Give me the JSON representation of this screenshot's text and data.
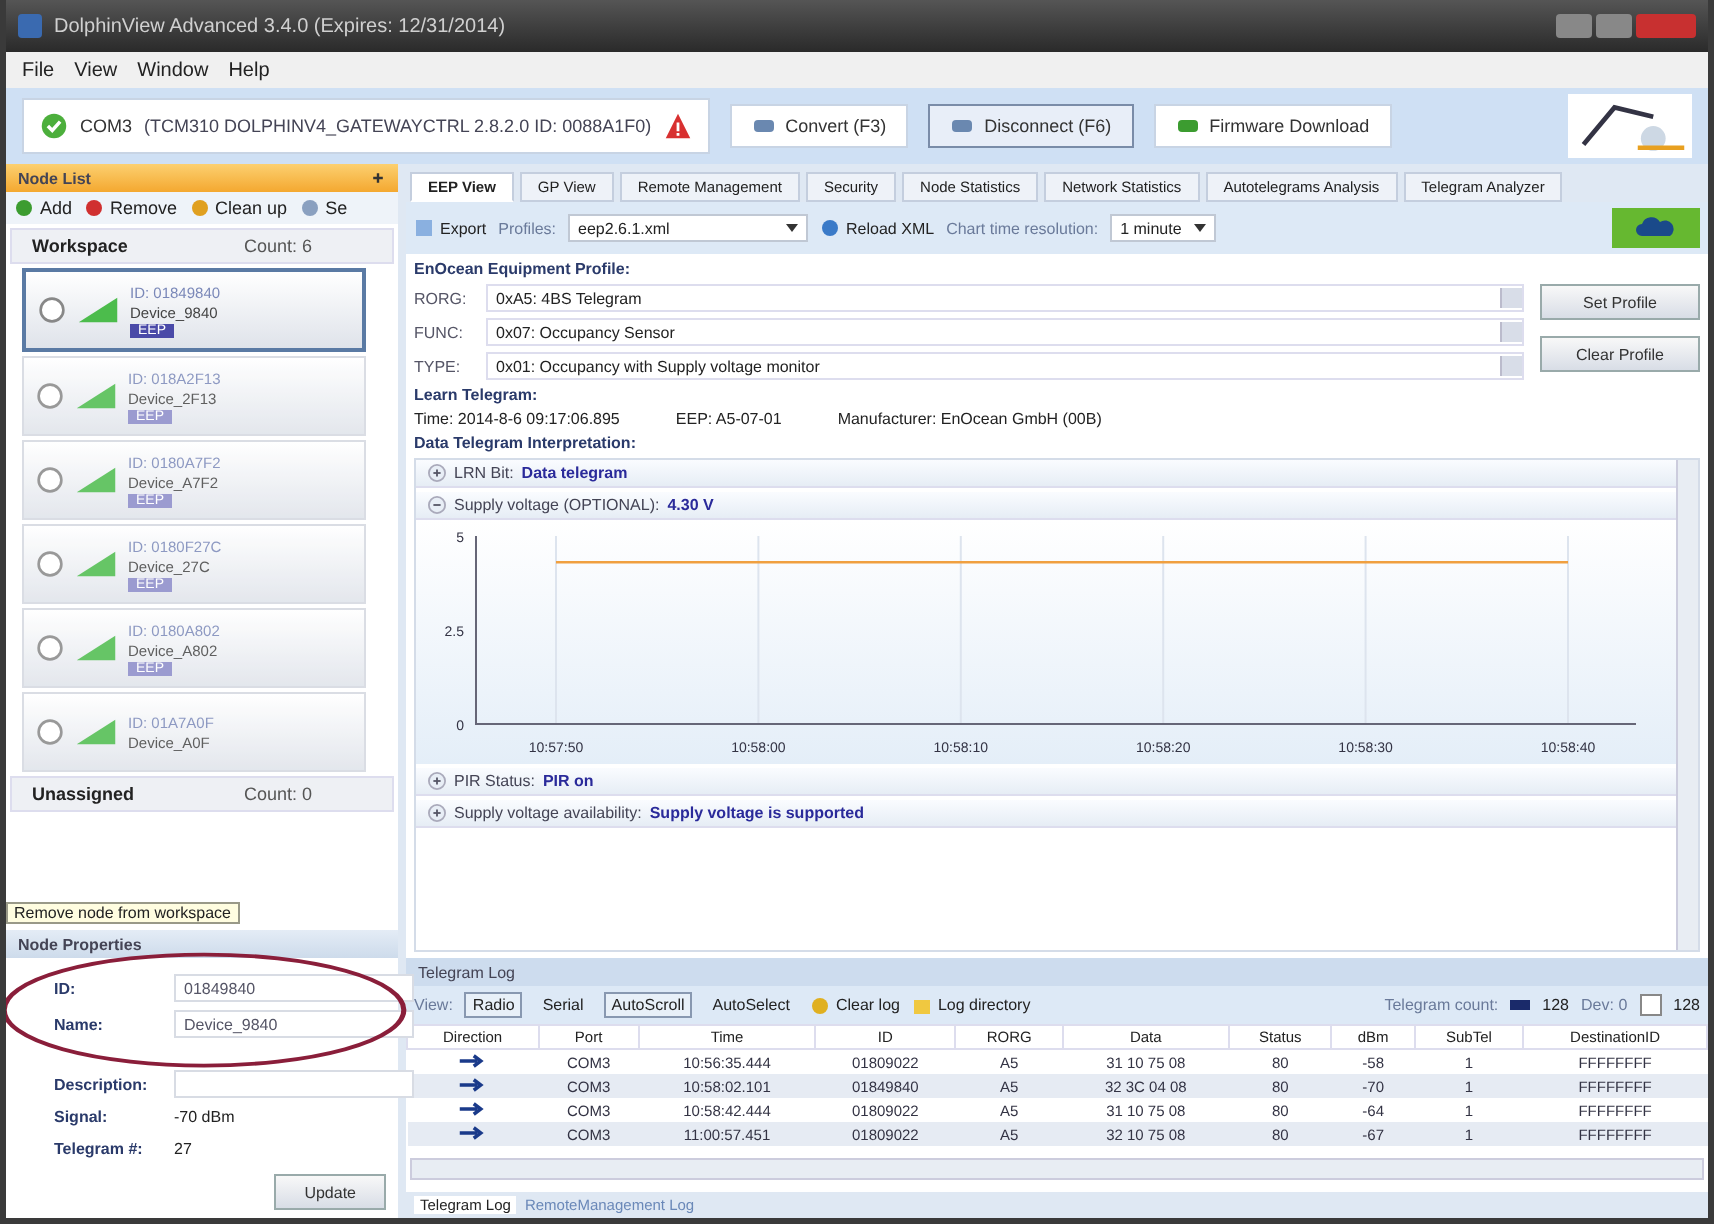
{
  "window": {
    "title": "DolphinView Advanced 3.4.0 (Expires: 12/31/2014)"
  },
  "menu": [
    "File",
    "View",
    "Window",
    "Help"
  ],
  "connection": {
    "port": "COM3",
    "info": "(TCM310 DOLPHINV4_GATEWAYCTRL 2.8.2.0 ID: 0088A1F0)",
    "buttons": [
      {
        "label": "Convert (F3)",
        "selected": false
      },
      {
        "label": "Disconnect (F6)",
        "selected": true
      },
      {
        "label": "Firmware Download",
        "selected": false
      }
    ]
  },
  "node_list": {
    "title": "Node List",
    "tools": [
      "Add",
      "Remove",
      "Clean up",
      "Se"
    ],
    "workspace": {
      "label": "Workspace",
      "count": "Count: 6"
    },
    "nodes": [
      {
        "id": "ID: 01849840",
        "name": "Device_9840",
        "badge": "EEP",
        "selected": true
      },
      {
        "id": "ID: 018A2F13",
        "name": "Device_2F13",
        "badge": "EEP",
        "selected": false
      },
      {
        "id": "ID: 0180A7F2",
        "name": "Device_A7F2",
        "badge": "EEP",
        "selected": false
      },
      {
        "id": "ID: 0180F27C",
        "name": "Device_27C",
        "badge": "EEP",
        "selected": false
      },
      {
        "id": "ID: 0180A802",
        "name": "Device_A802",
        "badge": "EEP",
        "selected": false
      },
      {
        "id": "ID: 01A7A0F",
        "name": "Device_A0F",
        "selected": false
      }
    ],
    "unassigned": {
      "label": "Unassigned",
      "count": "Count: 0"
    },
    "tooltip": "Remove node from workspace"
  },
  "node_properties": {
    "title": "Node Properties",
    "fields": [
      {
        "label": "ID:",
        "value": "01849840"
      },
      {
        "label": "Name:",
        "value": "Device_9840"
      },
      {
        "label": "Description:"
      }
    ],
    "signal": {
      "label": "Signal:",
      "value": "-70 dBm"
    },
    "telegrams": {
      "label": "Telegram #:",
      "value": "27"
    },
    "button": "Update"
  },
  "tabs": [
    {
      "label": "EEP View",
      "selected": true
    },
    {
      "label": "GP View",
      "selected": false
    },
    {
      "label": "Remote Management",
      "selected": false
    },
    {
      "label": "Security",
      "selected": false
    },
    {
      "label": "Node Statistics",
      "selected": false
    },
    {
      "label": "Network Statistics",
      "selected": false
    },
    {
      "label": "Autotelegrams Analysis",
      "selected": false
    },
    {
      "label": "Telegram Analyzer",
      "selected": false
    }
  ],
  "eep_toolbar": {
    "export": "Export",
    "profiles_label": "Profiles:",
    "profiles_value": "eep2.6.1.xml",
    "reload": "Reload XML",
    "resolution_label": "Chart time resolution:",
    "resolution_value": "1 minute"
  },
  "profile": {
    "title": "EnOcean Equipment Profile:",
    "rows": [
      {
        "label": "RORG:",
        "value": "0xA5: 4BS Telegram"
      },
      {
        "label": "FUNC:",
        "value": "0x07: Occupancy Sensor"
      },
      {
        "label": "TYPE:",
        "value": "0x01: Occupancy with Supply voltage monitor"
      }
    ],
    "buttons": [
      "Set Profile",
      "Clear Profile"
    ]
  },
  "learn": {
    "title": "Learn Telegram:",
    "time": "Time: 2014-8-6 09:17:06.895",
    "eep": "EEP: A5-07-01",
    "manufacturer": "Manufacturer: EnOcean GmbH (00B)"
  },
  "interpretation": {
    "title": "Data Telegram Interpretation:",
    "items": [
      {
        "label": "LRN Bit:",
        "value": "Data telegram",
        "expanded": false
      },
      {
        "label": "Supply voltage (OPTIONAL):",
        "value": "4.30 V",
        "expanded": true,
        "chart_data": {
          "type": "line",
          "categories": [
            "10:57:50",
            "10:58:00",
            "10:58:10",
            "10:58:20",
            "10:58:30",
            "10:58:40"
          ],
          "series": [
            {
              "color": "#f0a040",
              "values": [
                4.3,
                4.3,
                4.3,
                4.3,
                4.3,
                4.3
              ]
            }
          ],
          "grid": true,
          "ylim": [
            0,
            5
          ],
          "yticks": [
            0,
            {
              "value": 2.5,
              "label": "2.5"
            },
            5
          ]
        }
      },
      {
        "label": "PIR Status:",
        "value": "PIR on",
        "expanded": false
      },
      {
        "label": "Supply voltage availability:",
        "value": "Supply voltage is supported",
        "expanded": false
      }
    ]
  },
  "telegram_log": {
    "title": "Telegram Log",
    "view": "View:",
    "toggles": [
      {
        "label": "Radio",
        "on": true
      },
      {
        "label": "Serial",
        "on": false
      },
      {
        "label": "AutoScroll",
        "on": true
      },
      {
        "label": "AutoSelect",
        "on": false
      }
    ],
    "clear": "Clear log",
    "directory": "Log directory",
    "count_label": "Telegram count:",
    "count": "128",
    "dev": "Dev: 0",
    "limit": "128",
    "limit_checked": false,
    "columns": [
      "Direction",
      "Port",
      "Time",
      "ID",
      "RORG",
      "Data",
      "Status",
      "dBm",
      "SubTel",
      "DestinationID"
    ],
    "rows": [
      [
        "",
        "COM3",
        "10:56:35.444",
        "01809022",
        "A5",
        "31 10 75 08",
        "80",
        "-58",
        "1",
        "FFFFFFFF"
      ],
      [
        "",
        "COM3",
        "10:58:02.101",
        "01849840",
        "A5",
        "32 3C 04 08",
        "80",
        "-70",
        "1",
        "FFFFFFFF"
      ],
      [
        "",
        "COM3",
        "10:58:42.444",
        "01809022",
        "A5",
        "31 10 75 08",
        "80",
        "-64",
        "1",
        "FFFFFFFF"
      ],
      [
        "",
        "COM3",
        "11:00:57.451",
        "01809022",
        "A5",
        "32 10 75 08",
        "80",
        "-67",
        "1",
        "FFFFFFFF"
      ]
    ]
  },
  "bottom_tabs": [
    {
      "label": "Telegram Log",
      "selected": true
    },
    {
      "label": "RemoteManagement Log",
      "selected": false
    }
  ]
}
